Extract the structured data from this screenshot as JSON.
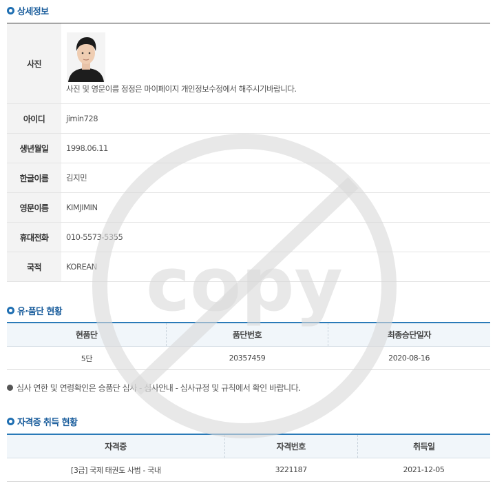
{
  "detail_section": {
    "title": "상세정보",
    "photo_label": "사진",
    "photo_note": "사진 및 영문이름 정정은 마이페이지 개인정보수정에서 해주시기바랍니다.",
    "rows": [
      {
        "label": "아이디",
        "value": "jimin728"
      },
      {
        "label": "생년월일",
        "value": "1998.06.11"
      },
      {
        "label": "한글이름",
        "value": "김지민"
      },
      {
        "label": "영문이름",
        "value": "KIMJIMIN"
      },
      {
        "label": "휴대전화",
        "value": "010-5573-5355"
      },
      {
        "label": "국적",
        "value": "KOREAN"
      }
    ]
  },
  "poom_section": {
    "title": "유·품단 현황",
    "headers": [
      "현품단",
      "품단번호",
      "최종승단일자"
    ],
    "rows": [
      [
        "5단",
        "20357459",
        "2020-08-16"
      ]
    ]
  },
  "notice": "심사 연한 및 연령확인은 승품단 심사 - 심사안내 - 심사규정 및 규칙에서 확인 바랍니다.",
  "cert_section": {
    "title": "자격증 취득 현황",
    "headers": [
      "자격증",
      "자격번호",
      "취득일"
    ],
    "rows": [
      [
        "[3급] 국제 태권도 사범 - 국내",
        "3221187",
        "2021-12-05"
      ]
    ]
  },
  "watermark": {
    "text": "copy",
    "color": "#d8d8d8",
    "icon": "no-copy-icon"
  },
  "colors": {
    "accent": "#1f6fb2",
    "header_bg": "#f3f3f3"
  }
}
